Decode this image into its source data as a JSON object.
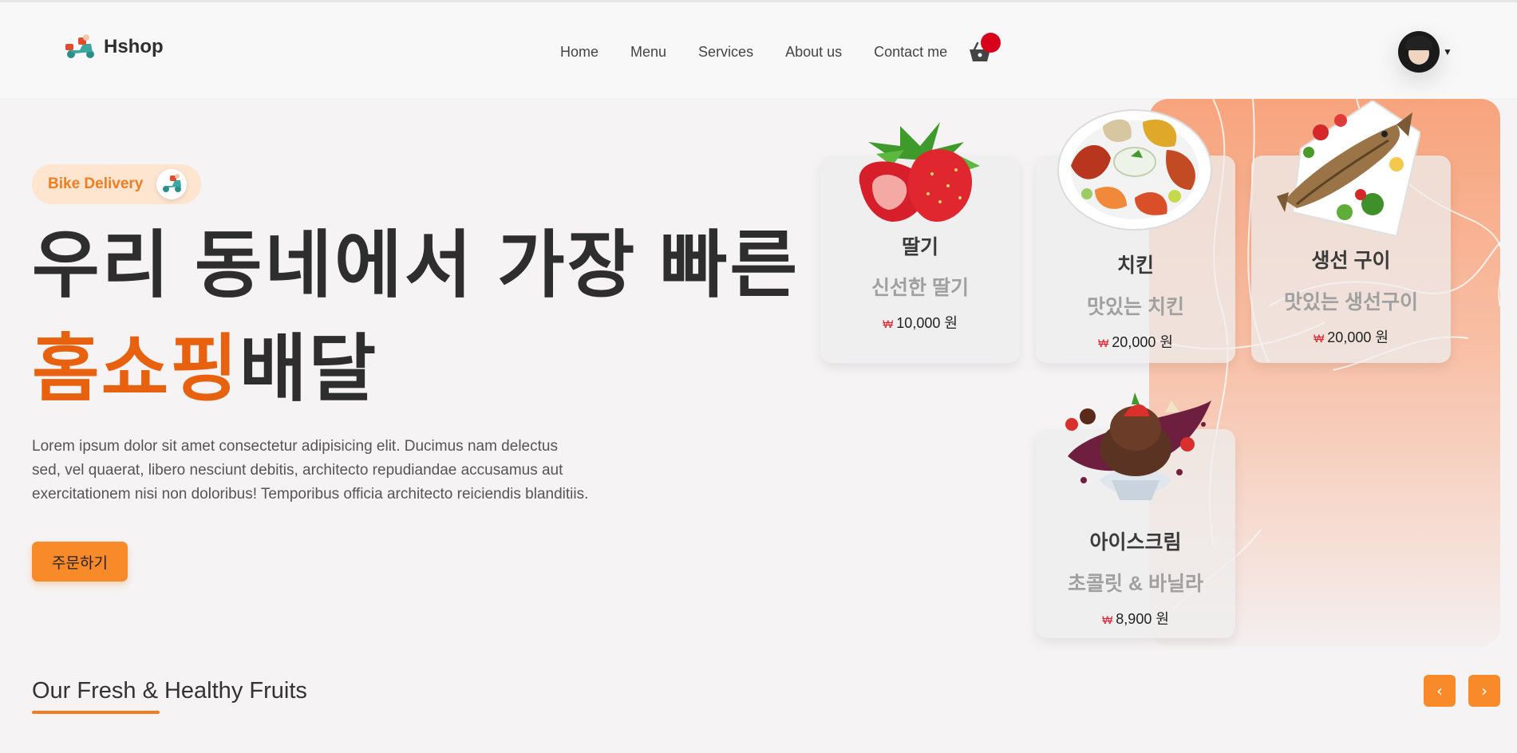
{
  "header": {
    "brand": "Hshop",
    "nav": [
      "Home",
      "Menu",
      "Services",
      "About us",
      "Contact me"
    ],
    "icons": {
      "logo": "delivery-scooter-icon",
      "cart": "basket-icon",
      "avatar_chevron": "chevron-down-icon"
    }
  },
  "hero": {
    "badge": "Bike Delivery",
    "headline_line1": "우리 동네에서 가장 빠른",
    "headline_accent": "홈쇼핑",
    "headline_rest": "배달",
    "description": "Lorem ipsum dolor sit amet consectetur adipisicing elit. Ducimus nam delectus sed, vel quaerat, libero nesciunt debitis, architecto repudiandae accusamus aut exercitationem nisi non doloribus! Temporibus officia architecto reiciendis blanditiis.",
    "order_button": "주문하기"
  },
  "menu_cards": [
    {
      "name": "딸기",
      "desc": "신선한 딸기",
      "currency": "₩",
      "price": "10,000 원",
      "image": "strawberries"
    },
    {
      "name": "치킨",
      "desc": "맛있는 치킨",
      "currency": "₩",
      "price": "20,000 원",
      "image": "chicken-platter"
    },
    {
      "name": "생선 구이",
      "desc": "맛있는 생선구이",
      "currency": "₩",
      "price": "20,000 원",
      "image": "grilled-fish"
    },
    {
      "name": "아이스크림",
      "desc": "초콜릿 & 바닐라",
      "currency": "₩",
      "price": "8,900 원",
      "image": "chocolate-ice-cream"
    }
  ],
  "section": {
    "title": "Our Fresh & Healthy Fruits",
    "prev": "‹",
    "next": "›"
  },
  "colors": {
    "accent": "#e8610f",
    "button": "#f98a2a",
    "cart_dot": "#d9001b",
    "panel": "#f7a47d"
  }
}
